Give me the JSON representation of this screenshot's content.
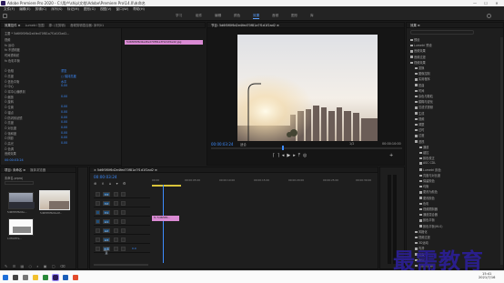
{
  "window": {
    "title": "Adobe Premiere Pro 2020 - C:\\用户\\ship\\文档\\Adobe\\Premiere Pro\\14.0\\未命名",
    "min": "—",
    "max": "☐",
    "close": "✕"
  },
  "menu": [
    "文件(F)",
    "编辑(E)",
    "剪辑(C)",
    "序列(S)",
    "标记(M)",
    "图形(G)",
    "视图(V)",
    "窗口(W)",
    "帮助(H)"
  ],
  "workspaces": [
    {
      "label": "学习",
      "active": false
    },
    {
      "label": "组件",
      "active": false
    },
    {
      "label": "编辑",
      "active": false
    },
    {
      "label": "颜色",
      "active": false
    },
    {
      "label": "效果",
      "active": true
    },
    {
      "label": "音频",
      "active": false
    },
    {
      "label": "图形",
      "active": false
    },
    {
      "label": "库",
      "active": false
    }
  ],
  "effect_controls": {
    "tabs": [
      "效果控件 ≡",
      "Lumetri 范围",
      "源: (无剪辑)",
      "音频剪辑混合器: 序列01"
    ],
    "source": "主要 * 5d6f0f0f6d2e4fed70f81a7f1d1f2ad2...",
    "clip_label": "5d6f0f0f6d2e4fed70f81a7f1d1f2ad2.jpg",
    "rows": [
      {
        "label": "视频",
        "value": ""
      },
      {
        "label": "fx 运动",
        "value": ""
      },
      {
        "label": "fx 不透明度",
        "value": ""
      },
      {
        "label": "时间重映射",
        "value": ""
      },
      {
        "label": "fx 色彩平衡",
        "value": ""
      },
      {
        "label": "",
        "value": ""
      },
      {
        "label": "Ö 色相",
        "value": "重复"
      },
      {
        "label": "Ö 亮度",
        "value": "□ 保持亮度"
      },
      {
        "label": "Ö 蓝色平衡",
        "value": "水平"
      },
      {
        "label": "Ö 中心",
        "value": "0.00"
      },
      {
        "label": "Ö 将中心偏移到",
        "value": ""
      },
      {
        "label": "Ö 缩放",
        "value": "0.00"
      },
      {
        "label": "Ö 旋转",
        "value": ""
      },
      {
        "label": "Ö 位置",
        "value": "0.00"
      },
      {
        "label": "Ö 锚点",
        "value": "0.00"
      },
      {
        "label": "Ö 防闪烁滤镜",
        "value": "0.00"
      },
      {
        "label": "Ö 亮度",
        "value": "0.00"
      },
      {
        "label": "Ö 对比度",
        "value": "0.00"
      },
      {
        "label": "Ö 饱和度",
        "value": "0.00"
      },
      {
        "label": "Ö 阴影",
        "value": "0.00"
      },
      {
        "label": "Ö 高光",
        "value": "0.00"
      },
      {
        "label": "Ö 色调",
        "value": ""
      },
      {
        "label": "音频效果",
        "value": ""
      }
    ],
    "timecode": "00:00:03:24"
  },
  "program": {
    "tab": "节目: 5d6f0f0f6d2e4fed70f81a7f1d1f2ad2 ≡",
    "timecode_left": "00:00:03:24",
    "fit": "适合",
    "zoom": "1/2",
    "timecode_right": "00:00:10:00"
  },
  "project": {
    "tabs": [
      "项目: 未命名 ≡",
      "媒体浏览器"
    ],
    "file": "未命名.prproj",
    "items": [
      {
        "name": "5d6f0f0f6d2e...",
        "duration": "5:00"
      },
      {
        "name": "5d6f0f0f6d2e4f...",
        "duration": "5:00"
      },
      {
        "name": "1d7b0f7e...",
        "duration": ""
      }
    ]
  },
  "timeline": {
    "tab": "× 5d6f0f0f6d2e4fed70f81a7f1d1f2ad2 ≡",
    "timecode": "00:00:03:24",
    "ruler": [
      "00:00",
      "00:00:05:00",
      "00:00:10:00",
      "00:00:15:00",
      "00:00:20:00",
      "00:00:25:00",
      "00:00:30:00"
    ],
    "tracks": [
      "V3",
      "V2",
      "V1",
      "A1",
      "A2",
      "A3",
      "主声道"
    ],
    "master_val": "0.0",
    "clip_label": "fx 5d6f0f0..."
  },
  "effects": {
    "tab": "效果 ≡",
    "tree": [
      "预设",
      "Lumetri 预设",
      "音频效果",
      "音频过渡",
      "视频效果",
      "变换",
      "图像控制",
      "实用程序",
      "扭曲",
      "时间",
      "杂色与颗粒",
      "模糊与锐化",
      "沉浸式视频",
      "生成",
      "视频",
      "调整",
      "过时",
      "过渡",
      "透视",
      "通道",
      "键控",
      "颜色校正",
      "ASC CDL",
      "Lumetri 颜色",
      "亮度与对比度",
      "保留颜色",
      "均衡",
      "更改为颜色",
      "更改颜色",
      "色彩",
      "视频限制器",
      "通道混合器",
      "颜色平衡",
      "颜色平衡(HLS)",
      "风格化",
      "视频过渡",
      "3D运动",
      "内滑",
      "划像",
      "擦除",
      "沉浸式视频"
    ]
  },
  "taskbar": {
    "time": "15:41",
    "date": "2021/7/16"
  },
  "watermark": "最需教育"
}
